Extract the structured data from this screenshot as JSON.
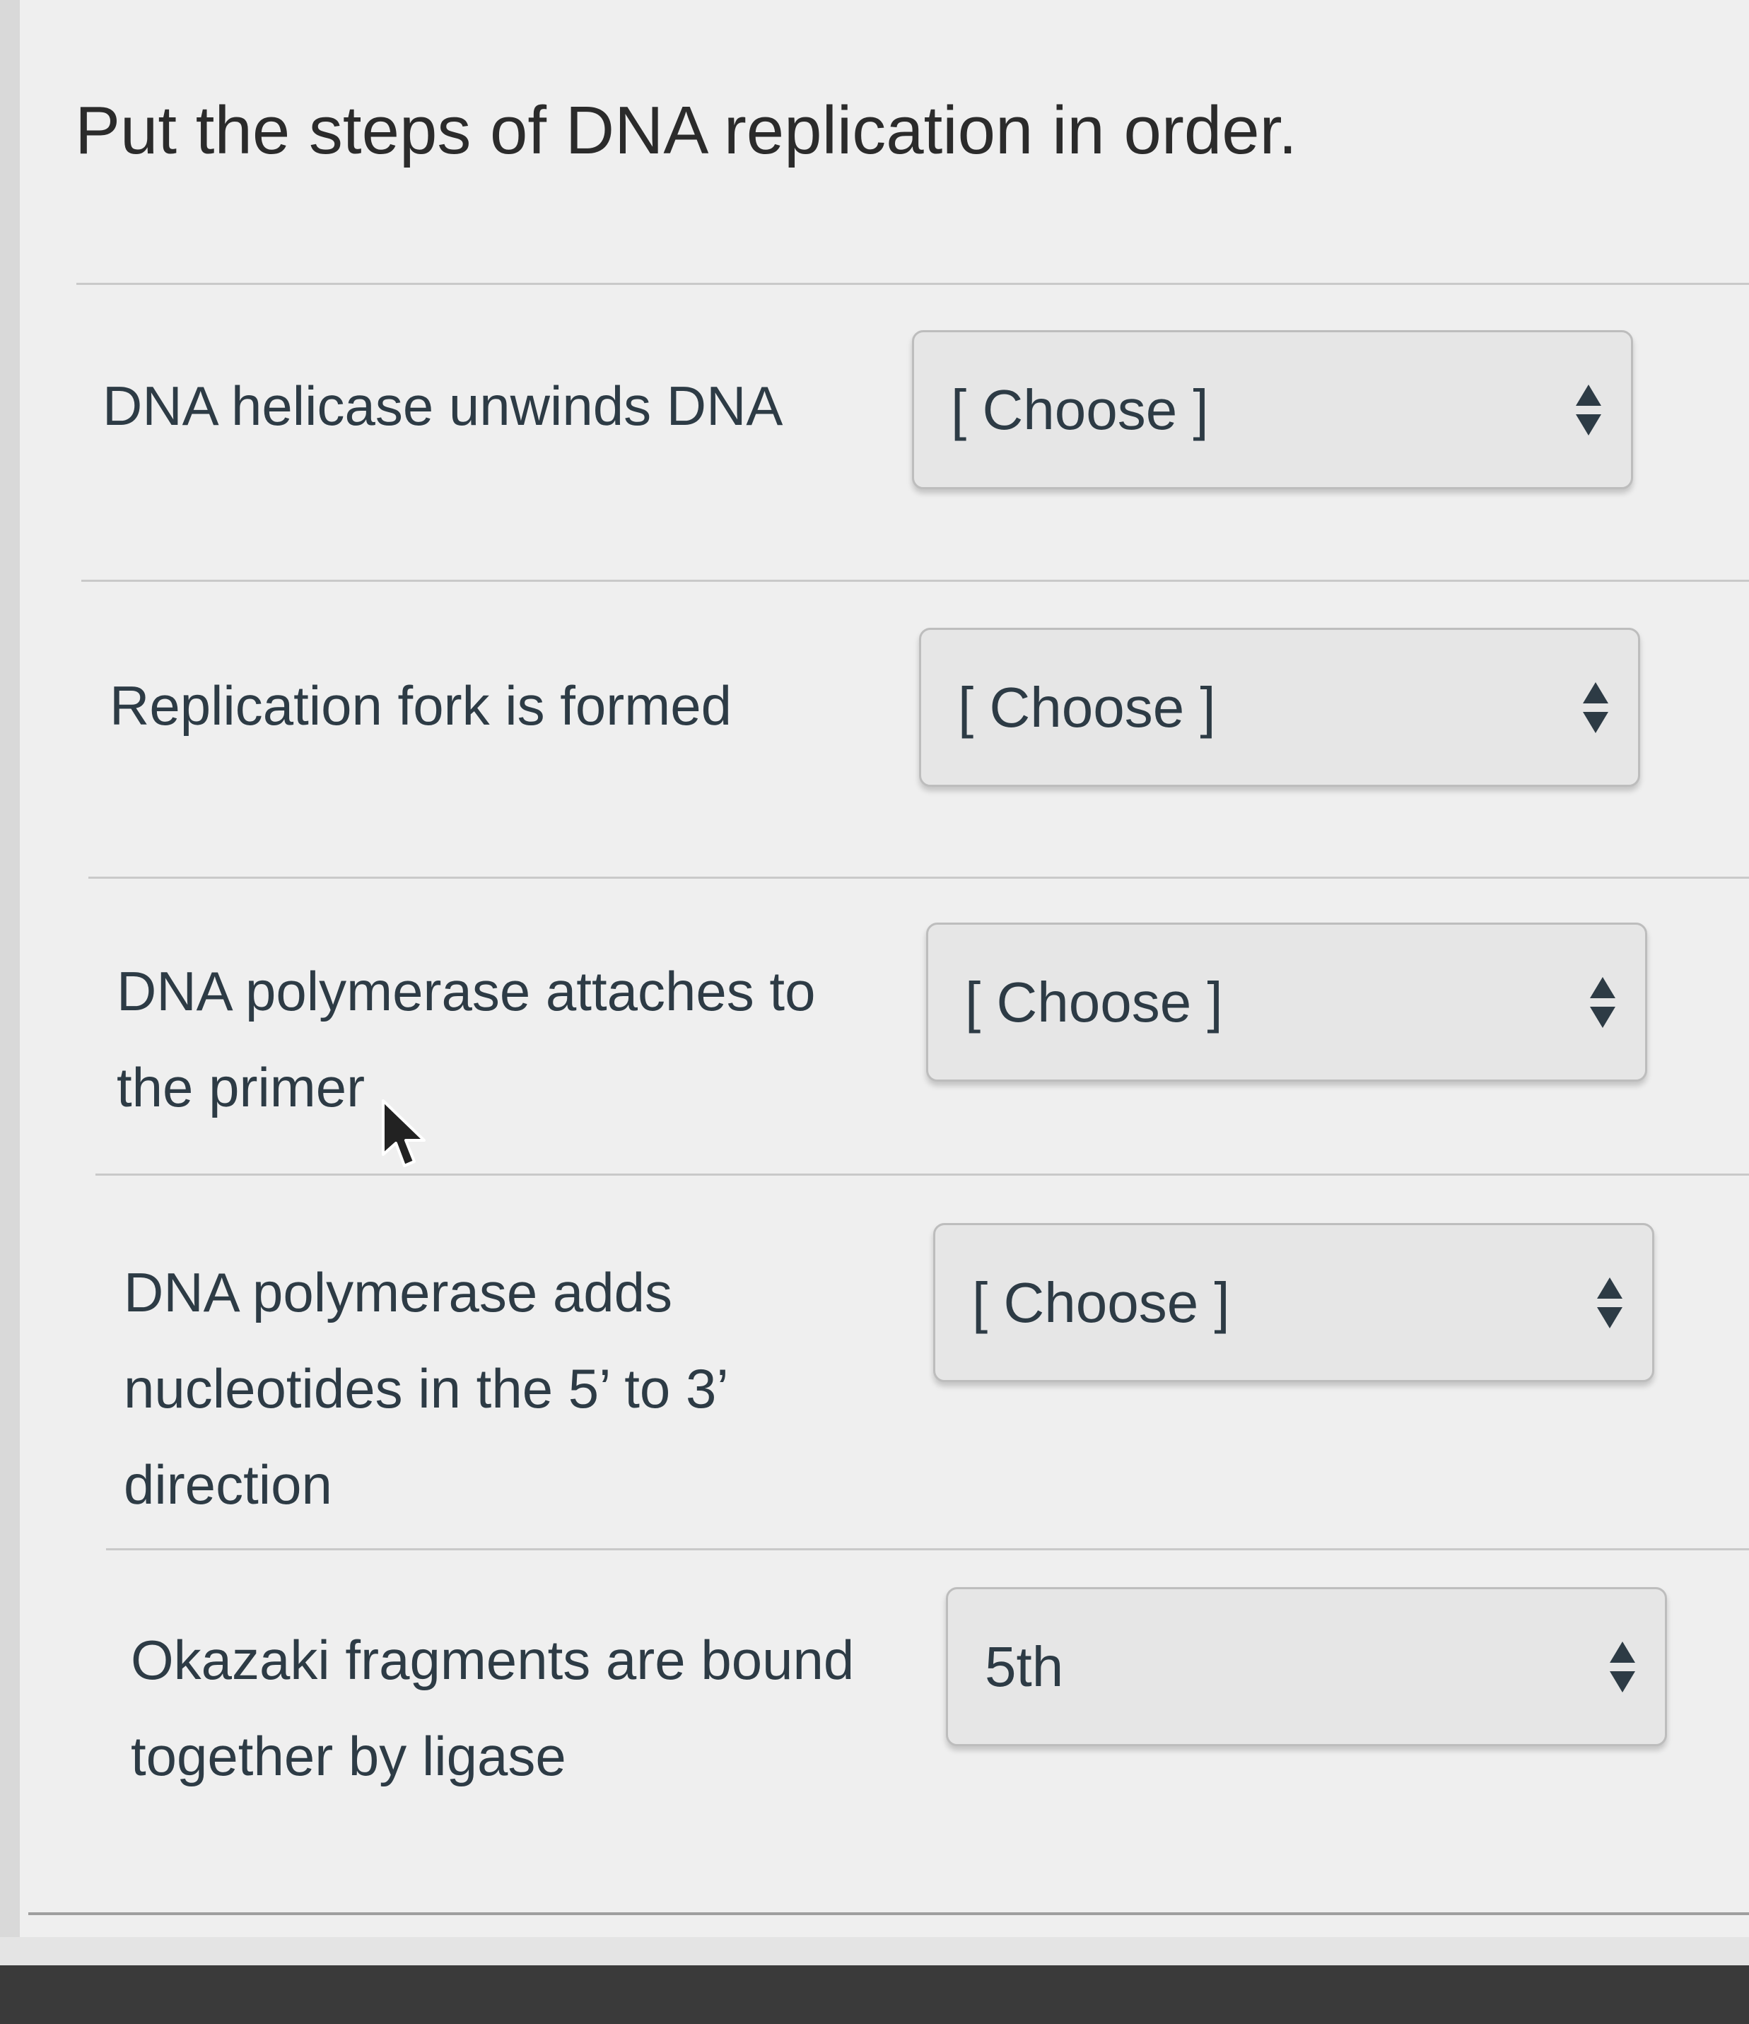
{
  "question": {
    "text": "Put the steps of DNA replication in order."
  },
  "rows": [
    {
      "label": "DNA helicase unwinds DNA",
      "selected": "[ Choose ]"
    },
    {
      "label": "Replication fork is formed",
      "selected": "[ Choose ]"
    },
    {
      "label": "DNA polymerase attaches to the primer",
      "selected": "[ Choose ]"
    },
    {
      "label": "DNA polymerase adds nucleotides in the 5’ to 3’ direction",
      "selected": "[ Choose ]"
    },
    {
      "label": "Okazaki fragments are bound together by ligase",
      "selected": "5th"
    }
  ],
  "icons": {
    "select_arrows": "up-down-arrows-icon",
    "cursor": "mouse-pointer-icon"
  },
  "colors": {
    "text": "#2d3b45",
    "select_bg": "#e6e6e6",
    "select_border": "#bdbdbd",
    "background": "#efefef"
  }
}
